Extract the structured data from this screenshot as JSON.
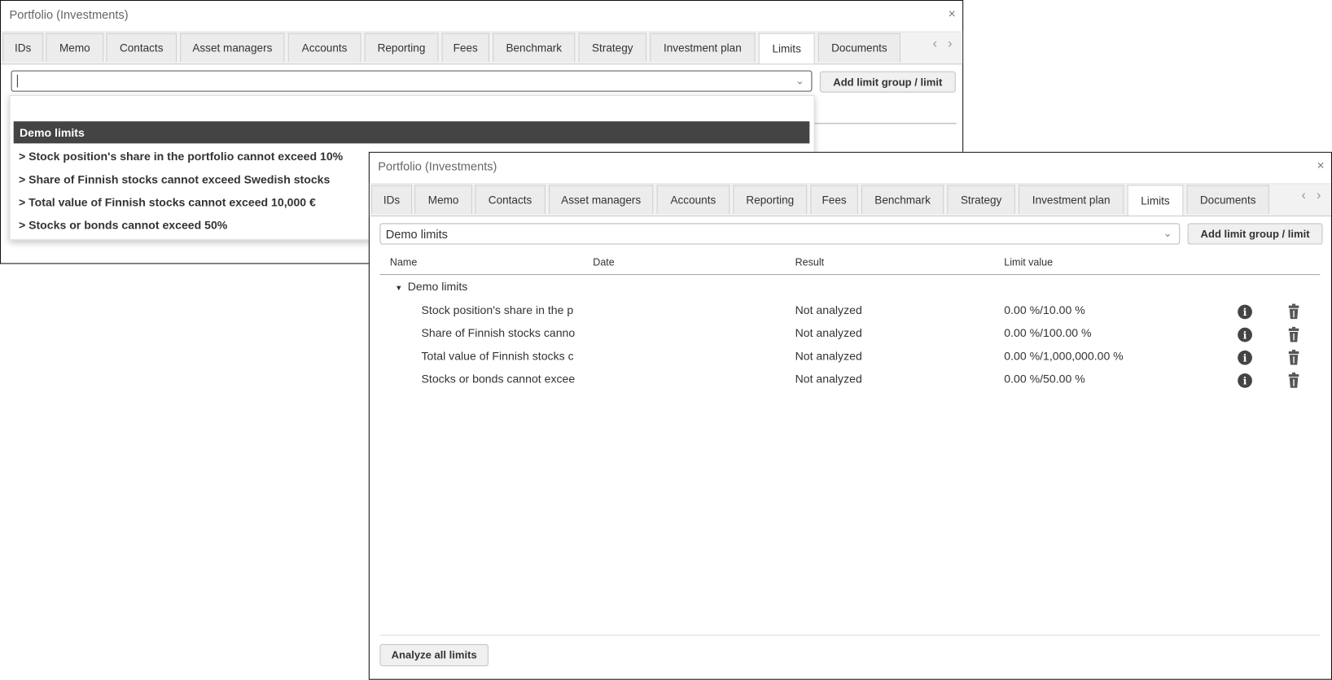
{
  "window_back": {
    "title": "Portfolio (Investments)",
    "close": "×",
    "tabs": [
      "IDs",
      "Memo",
      "Contacts",
      "Asset managers",
      "Accounts",
      "Reporting",
      "Fees",
      "Benchmark",
      "Strategy",
      "Investment plan",
      "Limits",
      "Documents"
    ],
    "active_tab": "Limits",
    "select_value": "",
    "add_button": "Add limit group / limit",
    "dropdown": {
      "group": "Demo limits",
      "items": [
        "> Stock position's share in the portfolio cannot exceed 10%",
        "> Share of Finnish stocks cannot exceed Swedish stocks",
        "> Total value of Finnish stocks cannot exceed 10,000 €",
        "> Stocks or bonds cannot exceed 50%"
      ]
    }
  },
  "window_front": {
    "title": "Portfolio (Investments)",
    "close": "×",
    "tabs": [
      "IDs",
      "Memo",
      "Contacts",
      "Asset managers",
      "Accounts",
      "Reporting",
      "Fees",
      "Benchmark",
      "Strategy",
      "Investment plan",
      "Limits",
      "Documents"
    ],
    "active_tab": "Limits",
    "select_value": "Demo limits",
    "add_button": "Add limit group / limit",
    "table": {
      "headers": {
        "name": "Name",
        "date": "Date",
        "result": "Result",
        "limit_value": "Limit value"
      },
      "group": "Demo limits",
      "rows": [
        {
          "name": "Stock position's share in the p",
          "date": "",
          "result": "Not analyzed",
          "limit_value": "0.00 %/10.00 %"
        },
        {
          "name": "Share of Finnish stocks canno",
          "date": "",
          "result": "Not analyzed",
          "limit_value": "0.00 %/100.00 %"
        },
        {
          "name": "Total value of Finnish stocks c",
          "date": "",
          "result": "Not analyzed",
          "limit_value": "0.00 %/1,000,000.00 %"
        },
        {
          "name": "Stocks or bonds cannot excee",
          "date": "",
          "result": "Not analyzed",
          "limit_value": "0.00 %/50.00 %"
        }
      ]
    },
    "analyze_button": "Analyze all limits"
  },
  "icons": {
    "info": "info-circle-icon",
    "trash": "trash-icon",
    "chevron": "chevron-down-icon",
    "caret": "caret-down-icon",
    "nav": "chevron-left-right-icon"
  },
  "colors": {
    "highlight": "#444444",
    "tab_bg": "#ececec",
    "text": "#333333"
  }
}
